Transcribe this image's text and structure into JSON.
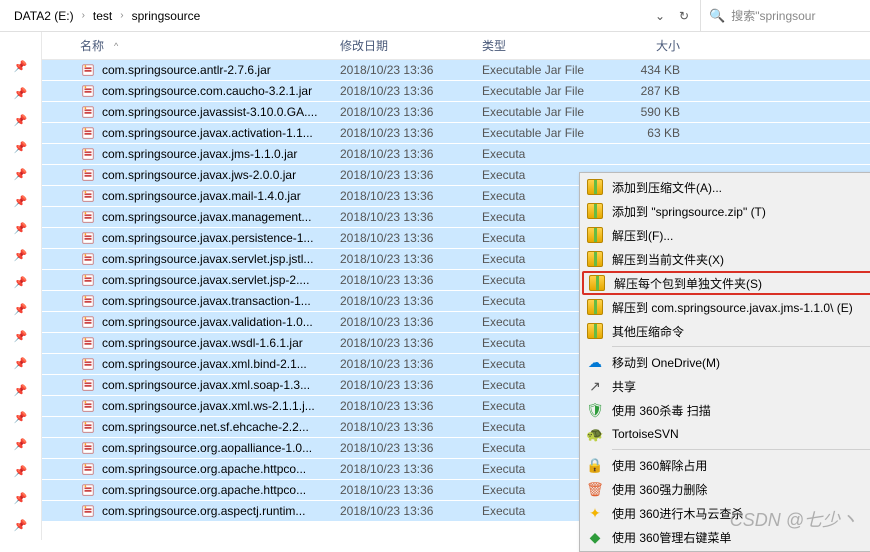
{
  "breadcrumb": {
    "parts": [
      "DATA2 (E:)",
      "test",
      "springsource"
    ]
  },
  "search": {
    "placeholder": "搜索\"springsour"
  },
  "headers": {
    "name": "名称",
    "date": "修改日期",
    "type": "类型",
    "size": "大小"
  },
  "files": [
    {
      "name": "com.springsource.antlr-2.7.6.jar",
      "date": "2018/10/23 13:36",
      "type": "Executable Jar File",
      "size": "434 KB"
    },
    {
      "name": "com.springsource.com.caucho-3.2.1.jar",
      "date": "2018/10/23 13:36",
      "type": "Executable Jar File",
      "size": "287 KB"
    },
    {
      "name": "com.springsource.javassist-3.10.0.GA....",
      "date": "2018/10/23 13:36",
      "type": "Executable Jar File",
      "size": "590 KB"
    },
    {
      "name": "com.springsource.javax.activation-1.1...",
      "date": "2018/10/23 13:36",
      "type": "Executable Jar File",
      "size": "63 KB"
    },
    {
      "name": "com.springsource.javax.jms-1.1.0.jar",
      "date": "2018/10/23 13:36",
      "type": "Executa",
      "size": ""
    },
    {
      "name": "com.springsource.javax.jws-2.0.0.jar",
      "date": "2018/10/23 13:36",
      "type": "Executa",
      "size": ""
    },
    {
      "name": "com.springsource.javax.mail-1.4.0.jar",
      "date": "2018/10/23 13:36",
      "type": "Executa",
      "size": ""
    },
    {
      "name": "com.springsource.javax.management...",
      "date": "2018/10/23 13:36",
      "type": "Executa",
      "size": ""
    },
    {
      "name": "com.springsource.javax.persistence-1...",
      "date": "2018/10/23 13:36",
      "type": "Executa",
      "size": ""
    },
    {
      "name": "com.springsource.javax.servlet.jsp.jstl...",
      "date": "2018/10/23 13:36",
      "type": "Executa",
      "size": ""
    },
    {
      "name": "com.springsource.javax.servlet.jsp-2....",
      "date": "2018/10/23 13:36",
      "type": "Executa",
      "size": ""
    },
    {
      "name": "com.springsource.javax.transaction-1...",
      "date": "2018/10/23 13:36",
      "type": "Executa",
      "size": ""
    },
    {
      "name": "com.springsource.javax.validation-1.0...",
      "date": "2018/10/23 13:36",
      "type": "Executa",
      "size": ""
    },
    {
      "name": "com.springsource.javax.wsdl-1.6.1.jar",
      "date": "2018/10/23 13:36",
      "type": "Executa",
      "size": ""
    },
    {
      "name": "com.springsource.javax.xml.bind-2.1...",
      "date": "2018/10/23 13:36",
      "type": "Executa",
      "size": ""
    },
    {
      "name": "com.springsource.javax.xml.soap-1.3...",
      "date": "2018/10/23 13:36",
      "type": "Executa",
      "size": ""
    },
    {
      "name": "com.springsource.javax.xml.ws-2.1.1.j...",
      "date": "2018/10/23 13:36",
      "type": "Executa",
      "size": ""
    },
    {
      "name": "com.springsource.net.sf.ehcache-2.2...",
      "date": "2018/10/23 13:36",
      "type": "Executa",
      "size": ""
    },
    {
      "name": "com.springsource.org.aopalliance-1.0...",
      "date": "2018/10/23 13:36",
      "type": "Executa",
      "size": ""
    },
    {
      "name": "com.springsource.org.apache.httpco...",
      "date": "2018/10/23 13:36",
      "type": "Executa",
      "size": ""
    },
    {
      "name": "com.springsource.org.apache.httpco...",
      "date": "2018/10/23 13:36",
      "type": "Executa",
      "size": ""
    },
    {
      "name": "com.springsource.org.aspectj.runtim...",
      "date": "2018/10/23 13:36",
      "type": "Executa",
      "size": ""
    }
  ],
  "menu": {
    "items": [
      {
        "icon": "archive-icon",
        "label": "添加到压缩文件(A)..."
      },
      {
        "icon": "archive-icon",
        "label": "添加到 \"springsource.zip\" (T)"
      },
      {
        "icon": "archive-icon",
        "label": "解压到(F)..."
      },
      {
        "icon": "archive-icon",
        "label": "解压到当前文件夹(X)"
      },
      {
        "icon": "archive-icon",
        "label": "解压每个包到单独文件夹(S)",
        "highlighted": true
      },
      {
        "icon": "archive-icon",
        "label": "解压到 com.springsource.javax.jms-1.1.0\\ (E)"
      },
      {
        "icon": "archive-icon",
        "label": "其他压缩命令"
      },
      {
        "sep": true
      },
      {
        "icon": "cloud-icon",
        "color": "#0078d4",
        "label": "移动到 OneDrive(M)"
      },
      {
        "icon": "share-icon",
        "color": "#555",
        "label": "共享"
      },
      {
        "icon": "shield-icon",
        "color": "#2e9c3b",
        "label": "使用 360杀毒 扫描"
      },
      {
        "icon": "tortoise-icon",
        "color": "#2e9c3b",
        "label": "TortoiseSVN"
      },
      {
        "sep": true
      },
      {
        "icon": "lock-icon",
        "color": "#f4b400",
        "label": "使用 360解除占用"
      },
      {
        "icon": "delete-icon",
        "color": "#e06030",
        "label": "使用 360强力删除"
      },
      {
        "icon": "scan-icon",
        "color": "#f4b400",
        "label": "使用 360进行木马云查杀"
      },
      {
        "icon": "menu360-icon",
        "color": "#2e9c3b",
        "label": "使用 360管理右键菜单"
      }
    ]
  },
  "watermark": "CSDN @七少丶"
}
